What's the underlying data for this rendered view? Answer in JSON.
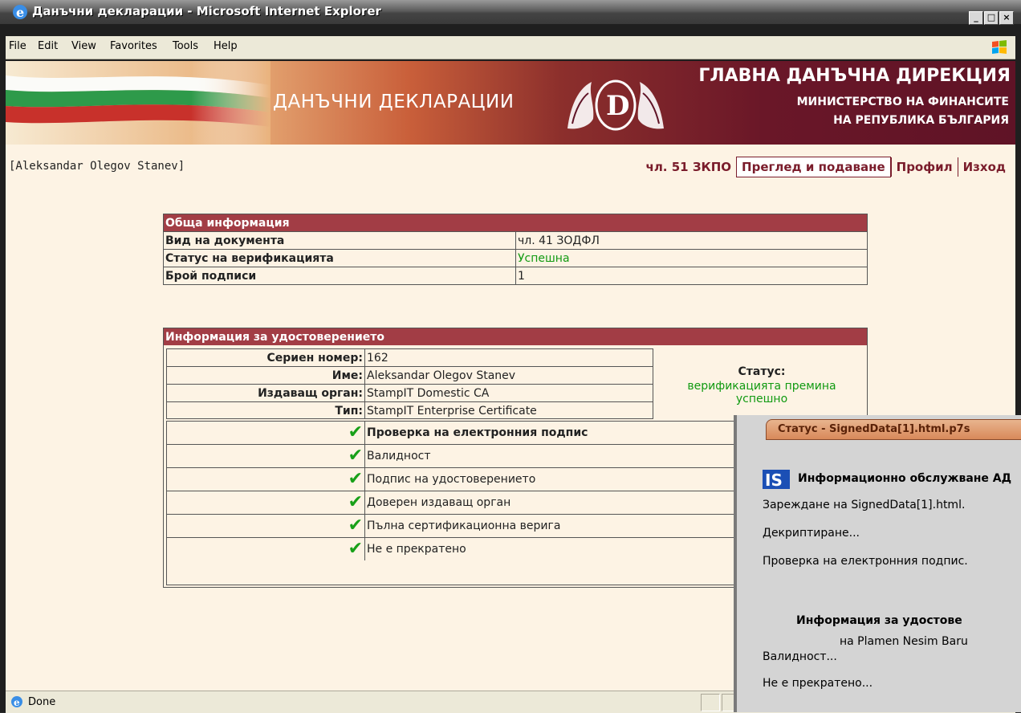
{
  "window": {
    "title": "Данъчни декларации - Microsoft Internet Explorer",
    "controls": [
      "_",
      "□",
      "×"
    ]
  },
  "menu": [
    "File",
    "Edit",
    "View",
    "Favorites",
    "Tools",
    "Help"
  ],
  "banner": {
    "site_title": "ДАНЪЧНИ ДЕКЛАРАЦИИ",
    "agency": "ГЛАВНА ДАНЪЧНА ДИРЕКЦИЯ",
    "ministry_line1": "МИНИСТЕРСТВО НА ФИНАНСИТЕ",
    "ministry_line2": "НА РЕПУБЛИКА БЪЛГАРИЯ"
  },
  "user": "[Aleksandar Olegov Stanev]",
  "nav": {
    "item1": "чл. 51 ЗКПО",
    "item2": "Преглед и подаване",
    "item3": "Профил",
    "item4": "Изход"
  },
  "general": {
    "header": "Обща информация",
    "rows": [
      {
        "label": "Вид на документа",
        "value": "чл. 41 ЗОДФЛ"
      },
      {
        "label": "Статус на верификацията",
        "value": "Успешна"
      },
      {
        "label": "Брой подписи",
        "value": "1"
      }
    ]
  },
  "cert": {
    "header": "Информация за удостоверението",
    "fields": [
      {
        "label": "Сериен номер:",
        "value": "162"
      },
      {
        "label": "Име:",
        "value": "Aleksandar Olegov Stanev"
      },
      {
        "label": "Издаващ орган:",
        "value": "StampIT Domestic CA"
      },
      {
        "label": "Тип:",
        "value": "StampIT Enterprise Certificate"
      }
    ],
    "status_label": "Статус:",
    "status_value_line1": "верификацията премина",
    "status_value_line2": "успешно",
    "checks": [
      "Проверка на електронния подпис",
      "Валидност",
      "Подпис на удостоверението",
      "Доверен издаващ орган",
      "Пълна сертификационна верига",
      "Не е прекратено"
    ]
  },
  "status_bar": {
    "text": "Done"
  },
  "popup": {
    "title": "Статус - SignedData[1].html.p7s",
    "company": "Информационно обслужване АД",
    "lines": [
      "Зареждане на SignedData[1].html.",
      "Декриптиране...",
      "Проверка на електронния подпис.",
      "Информация за удостове",
      "на Plamen Nesim Baru",
      "Валидност...",
      "Не е прекратено..."
    ]
  },
  "colors": {
    "accent": "#a23d45",
    "nav": "#7a1c2b",
    "success": "#119a11",
    "page_bg": "#fdf3e4"
  }
}
